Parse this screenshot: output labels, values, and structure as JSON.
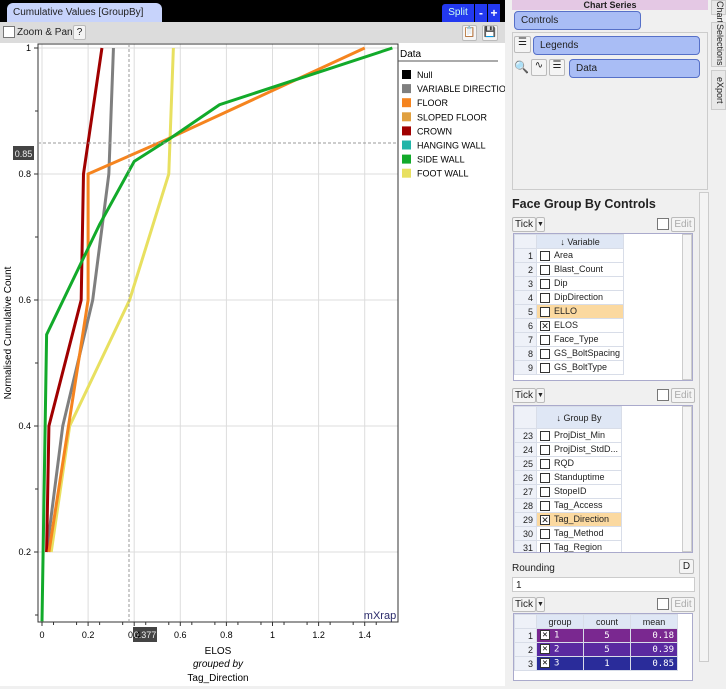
{
  "window": {
    "tab_title": "Cumulative Values [GroupBy]",
    "split_label": "Split",
    "minus_label": "-",
    "plus_label": "+"
  },
  "toolbar": {
    "zoom_pan_label": "Zoom & Pan",
    "help_label": "?"
  },
  "crosshair": {
    "y_readout": "0.85",
    "x_readout": "0.377"
  },
  "watermark": "mXrap",
  "chart_data": {
    "type": "line",
    "xlabel": "ELOS",
    "xlabel_sub1": "grouped by",
    "xlabel_sub2": "Tag_Direction",
    "ylabel": "Normalised Cumulative Count",
    "xlim": [
      0,
      1.52
    ],
    "ylim": [
      0.09,
      1.0
    ],
    "xticks": [
      "0",
      "0.2",
      "0.4",
      "0.6",
      "0.8",
      "1",
      "1.2",
      "1.4"
    ],
    "yticks": [
      "0.2",
      "0.4",
      "0.6",
      "0.8",
      "1"
    ],
    "grid": true,
    "legend_title": "Data",
    "legend_position": "right",
    "legend": [
      {
        "name": "Null",
        "color": "#000000"
      },
      {
        "name": "VARIABLE DIRECTION",
        "color": "#7f7f7f"
      },
      {
        "name": "FLOOR",
        "color": "#f5841f"
      },
      {
        "name": "SLOPED FLOOR",
        "color": "#e0a040"
      },
      {
        "name": "CROWN",
        "color": "#a00000"
      },
      {
        "name": "HANGING WALL",
        "color": "#20b5a8"
      },
      {
        "name": "SIDE WALL",
        "color": "#12aa2a"
      },
      {
        "name": "FOOT WALL",
        "color": "#e8e060"
      }
    ],
    "series": [
      {
        "name": "FOOT WALL",
        "color": "#e8e060",
        "points": [
          [
            0.04,
            0.2
          ],
          [
            0.12,
            0.4
          ],
          [
            0.38,
            0.6
          ],
          [
            0.55,
            0.8
          ],
          [
            0.57,
            1.0
          ]
        ]
      },
      {
        "name": "VARIABLE DIRECTION",
        "color": "#7f7f7f",
        "points": [
          [
            0.02,
            0.2
          ],
          [
            0.09,
            0.4
          ],
          [
            0.22,
            0.6
          ],
          [
            0.29,
            0.8
          ],
          [
            0.31,
            1.0
          ]
        ]
      },
      {
        "name": "CROWN",
        "color": "#a00000",
        "points": [
          [
            0.02,
            0.2
          ],
          [
            0.03,
            0.4
          ],
          [
            0.17,
            0.6
          ],
          [
            0.18,
            0.8
          ],
          [
            0.26,
            1.0
          ]
        ]
      },
      {
        "name": "FLOOR",
        "color": "#f5841f",
        "points": [
          [
            0.03,
            0.2
          ],
          [
            0.2,
            0.6
          ],
          [
            0.2,
            0.8
          ],
          [
            0.53,
            0.853
          ],
          [
            1.4,
            1.0
          ]
        ]
      },
      {
        "name": "SIDE WALL",
        "color": "#12aa2a",
        "points": [
          [
            0.0,
            0.09
          ],
          [
            0.02,
            0.545
          ],
          [
            0.25,
            0.72
          ],
          [
            0.4,
            0.82
          ],
          [
            0.55,
            0.855
          ],
          [
            0.77,
            0.91
          ],
          [
            1.52,
            1.0
          ]
        ]
      }
    ]
  },
  "right_panel": {
    "header": "Chart Series",
    "controls_label": "Controls",
    "legends_label": "Legends",
    "data_label": "Data",
    "side_tabs": [
      "Chart",
      "Selections",
      "eXport"
    ],
    "section_title": "Face Group By Controls",
    "tick_label": "Tick",
    "edit_label": "Edit",
    "variable_header": "Variable",
    "variables": [
      {
        "n": "1",
        "name": "Area",
        "checked": false
      },
      {
        "n": "2",
        "name": "Blast_Count",
        "checked": false
      },
      {
        "n": "3",
        "name": "Dip",
        "checked": false
      },
      {
        "n": "4",
        "name": "DipDirection",
        "checked": false
      },
      {
        "n": "5",
        "name": "ELLO",
        "checked": false,
        "highlight": true
      },
      {
        "n": "6",
        "name": "ELOS",
        "checked": true
      },
      {
        "n": "7",
        "name": "Face_Type",
        "checked": false
      },
      {
        "n": "8",
        "name": "GS_BoltSpacing",
        "checked": false
      },
      {
        "n": "9",
        "name": "GS_BoltType",
        "checked": false
      }
    ],
    "groupby_header": "Group By",
    "groupby": [
      {
        "n": "23",
        "name": "ProjDist_Min",
        "checked": false
      },
      {
        "n": "24",
        "name": "ProjDist_StdD...",
        "checked": false
      },
      {
        "n": "25",
        "name": "RQD",
        "checked": false
      },
      {
        "n": "26",
        "name": "Standuptime",
        "checked": false
      },
      {
        "n": "27",
        "name": "StopeID",
        "checked": false
      },
      {
        "n": "28",
        "name": "Tag_Access",
        "checked": false
      },
      {
        "n": "29",
        "name": "Tag_Direction",
        "checked": true,
        "highlight": true
      },
      {
        "n": "30",
        "name": "Tag_Method",
        "checked": false
      },
      {
        "n": "31",
        "name": "Tag_Region",
        "checked": false
      }
    ],
    "rounding_label": "Rounding",
    "rounding_button": "D",
    "rounding_value": "1",
    "groups_headers": [
      "group",
      "count",
      "mean"
    ],
    "groups": [
      {
        "n": "1",
        "group": "1",
        "count": "5",
        "mean": "0.18",
        "color": "#7a2890"
      },
      {
        "n": "2",
        "group": "2",
        "count": "5",
        "mean": "0.39",
        "color": "#5a2aa0"
      },
      {
        "n": "3",
        "group": "3",
        "count": "1",
        "mean": "0.85",
        "color": "#2a2c9a"
      }
    ]
  }
}
